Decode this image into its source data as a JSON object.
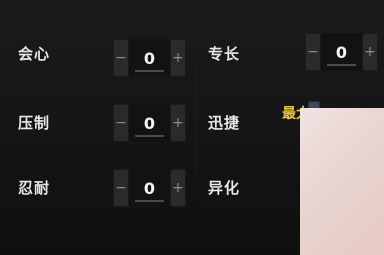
{
  "stats": {
    "left": [
      {
        "label": "会心",
        "value": "0",
        "minus": "−",
        "plus": "+"
      },
      {
        "label": "压制",
        "value": "0",
        "minus": "−",
        "plus": "+"
      },
      {
        "label": "忍耐",
        "value": "0",
        "minus": "−",
        "plus": "+"
      }
    ],
    "right": [
      {
        "label": "专长",
        "value": "0",
        "minus": "−",
        "plus": "+"
      },
      {
        "label": "迅捷"
      },
      {
        "label": "异化"
      }
    ]
  },
  "max_tag": "最大",
  "icons": {
    "minus": "minus-icon",
    "plus": "plus-icon"
  },
  "colors": {
    "background": "#151515",
    "label": "#e9e9e9",
    "button": "#2a2a2a",
    "value_bg": "#121212",
    "accent_gold": "#e9c845",
    "overlay": "#ecd8d6"
  }
}
